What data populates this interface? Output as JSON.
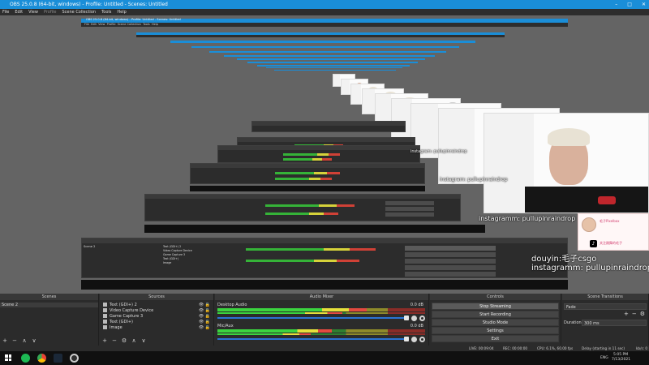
{
  "window": {
    "title": "OBS 25.0.8 (64-bit, windows) - Profile: Untitled - Scenes: Untitled",
    "controls": [
      "–",
      "□",
      "✕"
    ]
  },
  "menu": [
    {
      "label": "File",
      "enabled": true
    },
    {
      "label": "Edit",
      "enabled": true
    },
    {
      "label": "View",
      "enabled": true
    },
    {
      "label": "Profile",
      "enabled": false
    },
    {
      "label": "Scene Collection",
      "enabled": true
    },
    {
      "label": "Tools",
      "enabled": true
    },
    {
      "label": "Help",
      "enabled": true
    }
  ],
  "nested_window": {
    "title": "OBS 25.0.8 (64-bit, windows) - Profile: Untitled - Scenes: Untitled",
    "menu": [
      "File",
      "Edit",
      "View",
      "Profile",
      "Scene Collection",
      "Tools",
      "Help"
    ]
  },
  "overlays": {
    "instagram_small": "instagram: pullupinraindrop",
    "instagram_mid": "instagram: pullupinraindrop",
    "instagram_large": "instagramm: pullupinraindrop",
    "douyin": "douyin:毛子csgo",
    "instagram_main": "instagramm: pullupinraindrop",
    "card_line1": "毛子Pixelbox",
    "card_line2": "关注跳舞的毛子"
  },
  "docks": {
    "scenes": {
      "title": "Scenes",
      "items": [
        "Scene 2"
      ],
      "toolbar": [
        "+",
        "−",
        "∧",
        "∨"
      ]
    },
    "sources": {
      "title": "Sources",
      "items": [
        "Text (GDI+) 2",
        "Video Capture Device",
        "Game Capture 3",
        "Text (GDI+)",
        "Image"
      ],
      "toolbar": [
        "+",
        "−",
        "⚙",
        "∧",
        "∨"
      ]
    },
    "mixer": {
      "title": "Audio Mixer",
      "channels": [
        {
          "name": "Desktop Audio",
          "db": "0.0 dB",
          "level": 0.72
        },
        {
          "name": "Mic/Aux",
          "db": "0.0 dB",
          "level": 0.55
        }
      ]
    },
    "controls": {
      "title": "Controls",
      "buttons": [
        "Stop Streaming",
        "Start Recording",
        "Studio Mode",
        "Settings",
        "Exit"
      ]
    },
    "transitions": {
      "title": "Scene Transitions",
      "selected": "Fade",
      "duration_label": "Duration",
      "duration_value": "300 ms",
      "toolbar": [
        "+",
        "−",
        "⚙"
      ]
    }
  },
  "status": {
    "live": "LIVE: 00:09:04",
    "rec": "REC: 00:00:00",
    "cpu": "CPU: 6.1%, 60.00 fps",
    "delay": "Delay (starting in 11 sec)",
    "kbps": "kb/s: 0"
  },
  "taskbar": {
    "lang": "ENG",
    "time": "5:05 PM",
    "date": "7/13/2021"
  },
  "colors": {
    "accent": "#1a8ed8",
    "dock_bg": "#2b2b2b",
    "meter_green": "#3bd43f",
    "meter_yellow": "#e5e03b",
    "meter_red": "#e34a3f"
  }
}
